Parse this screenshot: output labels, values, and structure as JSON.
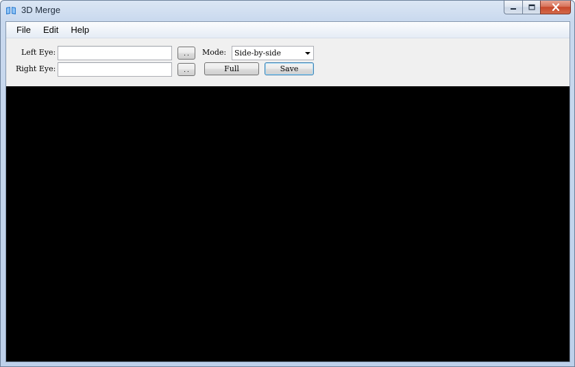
{
  "window": {
    "title": "3D Merge",
    "icon": "book-icon"
  },
  "menu": {
    "items": [
      "File",
      "Edit",
      "Help"
    ]
  },
  "form": {
    "left_eye_label": "Left Eye:",
    "left_eye_value": "",
    "right_eye_label": "Right Eye:",
    "right_eye_value": "",
    "browse_label": "..",
    "mode_label": "Mode:",
    "mode_selected": "Side-by-side",
    "full_label": "Full",
    "save_label": "Save"
  },
  "colors": {
    "preview_background": "#000000",
    "accent_default_button": "#3c7fb1"
  }
}
